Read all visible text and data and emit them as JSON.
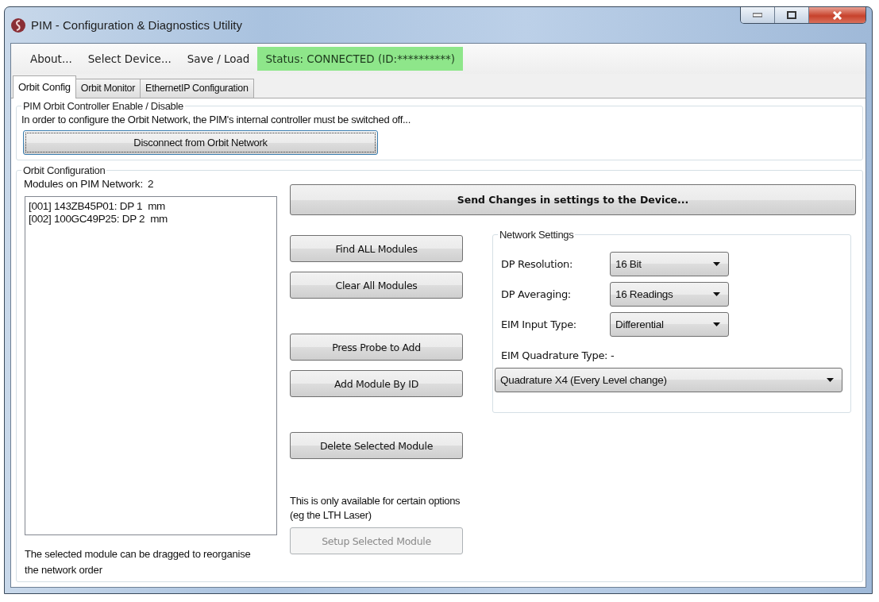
{
  "window": {
    "title": "PIM - Configuration & Diagnostics Utility"
  },
  "menu": [
    {
      "label": "About..."
    },
    {
      "label": "Select Device..."
    },
    {
      "label": "Save / Load"
    }
  ],
  "status": {
    "text": "Status: CONNECTED (ID:**********)",
    "color": "#8ee68a"
  },
  "tabs": [
    {
      "label": "Orbit Config",
      "selected": true
    },
    {
      "label": "Orbit Monitor",
      "selected": false
    },
    {
      "label": "EthernetIP Configuration",
      "selected": false
    }
  ],
  "controller_group": {
    "title": "PIM Orbit Controller Enable / Disable",
    "message": "In order to configure the Orbit Network, the PIM's internal controller must be switched off...",
    "button": {
      "label": "Disconnect from Orbit Network",
      "focused": true
    }
  },
  "config_group": {
    "title": "Orbit Configuration",
    "modules_label": "Modules on PIM Network:",
    "modules_count": "2",
    "modules": [
      {
        "text": "[001] 143ZB45P01: DP 1  mm",
        "selected": false
      },
      {
        "text": "[002] 100GC49P25: DP 2  mm",
        "selected": false
      }
    ],
    "drag_note": "The selected module can be dragged to reorganise the network order",
    "send_button": {
      "label": "Send Changes in settings to the Device...",
      "disabled": false
    },
    "buttons": [
      {
        "label": "Find ALL Modules",
        "disabled": false
      },
      {
        "label": "Clear All Modules",
        "disabled": false
      },
      {
        "label": "Press Probe to Add",
        "disabled": false
      },
      {
        "label": "Add Module By ID",
        "disabled": false
      },
      {
        "label": "Delete Selected Module",
        "disabled": false
      }
    ],
    "setup_note": "This is only available for certain options (eg the LTH Laser)",
    "setup_button": {
      "label": "Setup Selected Module",
      "disabled": true
    }
  },
  "network_settings": {
    "title": "Network Settings",
    "fields": [
      {
        "label": "DP Resolution:",
        "value": "16 Bit"
      },
      {
        "label": "DP Averaging:",
        "value": "16 Readings"
      },
      {
        "label": "EIM Input Type:",
        "value": "Differential"
      }
    ],
    "quadrature": {
      "label": "EIM Quadrature Type: -",
      "value": "Quadrature X4 (Every Level change)"
    }
  }
}
